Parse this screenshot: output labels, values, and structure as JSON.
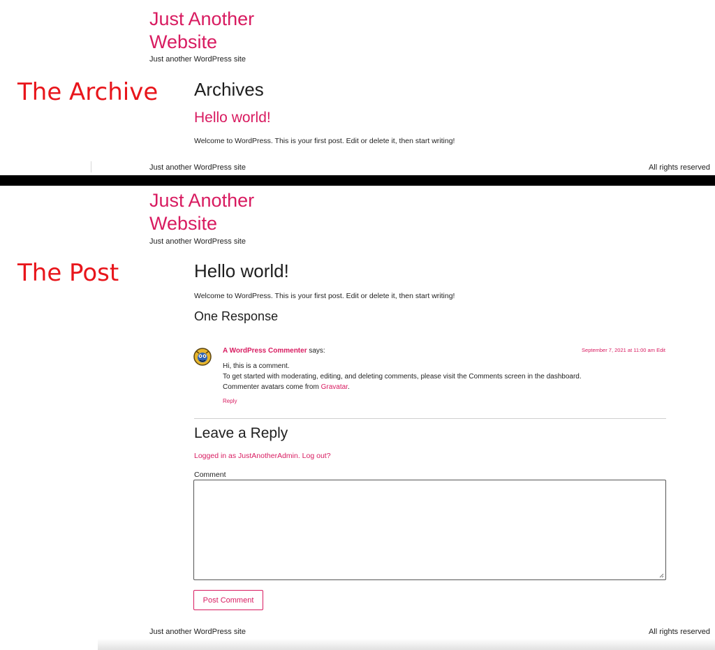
{
  "colors": {
    "accent": "#d81b60",
    "annotation": "#e8151b",
    "text": "#1e1e1e"
  },
  "archive_view": {
    "annotation": "The Archive",
    "site_title_line1": "Just Another",
    "site_title_line2": "Website",
    "tagline": "Just another WordPress site",
    "page_heading": "Archives",
    "post_title": "Hello world!",
    "post_excerpt": "Welcome to WordPress. This is your first post. Edit or delete it, then start writing!",
    "footer_left": "Just another WordPress site",
    "footer_right": "All rights reserved"
  },
  "post_view": {
    "annotation": "The Post",
    "site_title_line1": "Just Another",
    "site_title_line2": "Website",
    "tagline": "Just another WordPress site",
    "post_title": "Hello world!",
    "post_content": "Welcome to WordPress. This is your first post. Edit or delete it, then start writing!",
    "responses_heading": "One Response",
    "comment": {
      "author": "A WordPress Commenter",
      "says": "says:",
      "date": "September 7, 2021 at 11:00 am",
      "edit": "Edit",
      "line1": "Hi, this is a comment.",
      "line2": "To get started with moderating, editing, and deleting comments, please visit the Comments screen in the dashboard.",
      "line3_prefix": "Commenter avatars come from",
      "line3_link": "Gravatar",
      "line3_suffix": ".",
      "reply": "Reply",
      "avatar_icon": "commenter-avatar-icon"
    },
    "reply_heading": "Leave a Reply",
    "logged_in_text": "Logged in as JustAnotherAdmin. Log out?",
    "comment_label": "Comment",
    "comment_value": "",
    "submit_label": "Post Comment",
    "footer_left": "Just another WordPress site",
    "footer_right": "All rights reserved"
  }
}
